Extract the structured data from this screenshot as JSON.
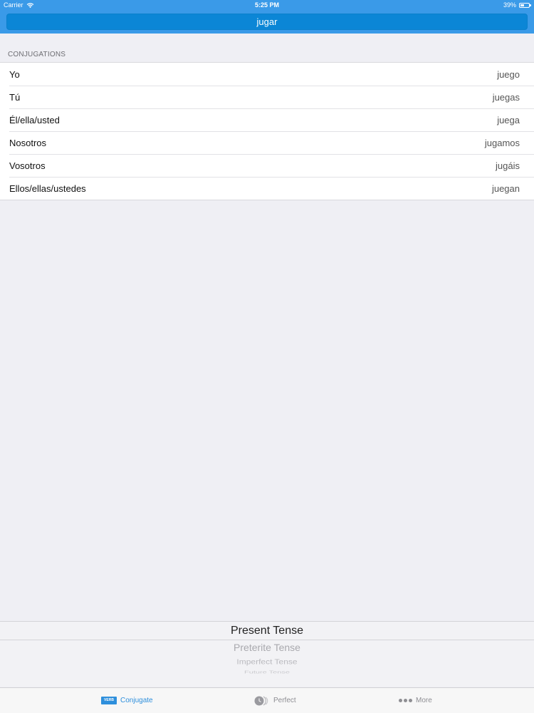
{
  "status_bar": {
    "carrier": "Carrier",
    "time": "5:25 PM",
    "battery": "39%"
  },
  "verb_input": {
    "value": "jugar"
  },
  "conjugations": {
    "header": "CONJUGATIONS",
    "rows": [
      {
        "pronoun": "Yo",
        "form": "juego"
      },
      {
        "pronoun": "Tú",
        "form": "juegas"
      },
      {
        "pronoun": "Él/ella/usted",
        "form": "juega"
      },
      {
        "pronoun": "Nosotros",
        "form": "jugamos"
      },
      {
        "pronoun": "Vosotros",
        "form": "jugáis"
      },
      {
        "pronoun": "Ellos/ellas/ustedes",
        "form": "juegan"
      }
    ]
  },
  "tense_picker": {
    "options": [
      "Present Tense",
      "Preterite Tense",
      "Imperfect Tense",
      "Future Tense"
    ],
    "selected": "Present Tense"
  },
  "tab_bar": {
    "items": [
      {
        "label": "Conjugate",
        "icon": "verb-icon",
        "icon_text": "VERB",
        "active": true
      },
      {
        "label": "Perfect",
        "icon": "perfect-icon",
        "active": false
      },
      {
        "label": "More",
        "icon": "more-dots-icon",
        "active": false
      }
    ]
  },
  "colors": {
    "nav_blue": "#3a9ae8",
    "field_blue": "#0b86d6",
    "accent": "#2e8fdc",
    "background": "#efeff4"
  }
}
